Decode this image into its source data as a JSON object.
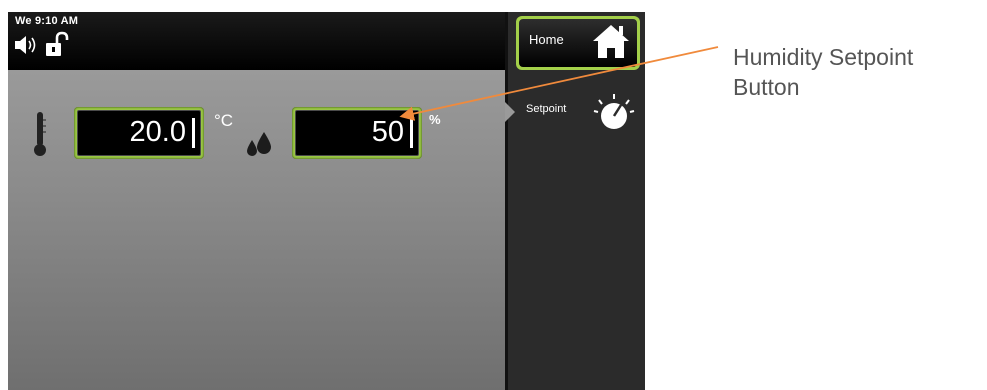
{
  "status": {
    "clock": "We 9:10 AM"
  },
  "readings": {
    "temperature": {
      "value": "20.0",
      "unit": "°C"
    },
    "humidity": {
      "value": "50",
      "unit": "%"
    }
  },
  "menu": {
    "home_label": "Home",
    "setpoint_label": "Setpoint"
  },
  "annotation": {
    "text": "Humidity Setpoint Button"
  },
  "colors": {
    "field_border": "#9ac844",
    "annotation_arrow": "#f08a3c"
  },
  "icons": [
    "speaker-icon",
    "unlock-icon",
    "thermometer-icon",
    "droplets-icon",
    "home-icon",
    "dial-icon"
  ]
}
